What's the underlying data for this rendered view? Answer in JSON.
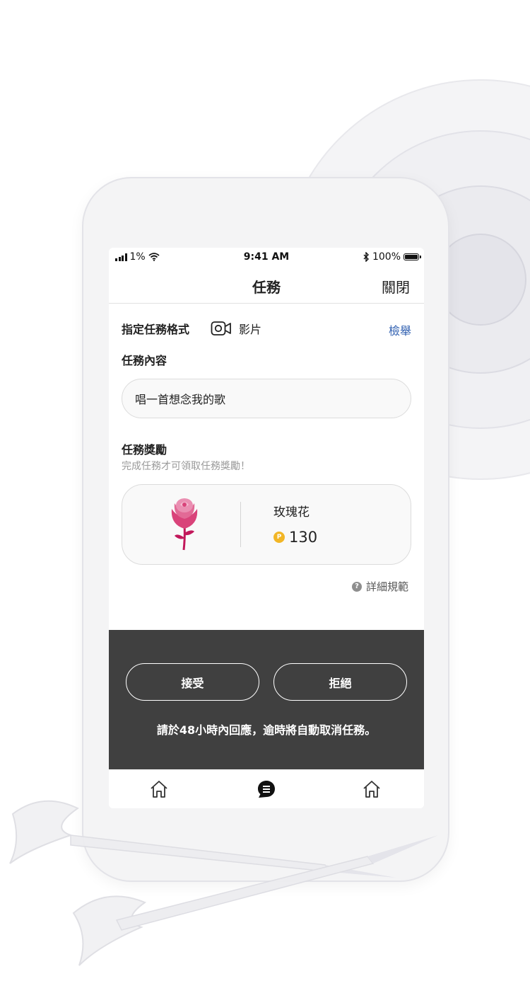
{
  "status_bar": {
    "signal_text": "1%",
    "time": "9:41 AM",
    "battery_text": "100%"
  },
  "nav": {
    "title": "任務",
    "close_label": "關閉"
  },
  "task": {
    "format_label": "指定任務格式",
    "format_icon": "video-camera-icon",
    "format_value": "影片",
    "report_label": "檢舉",
    "content_title": "任務內容",
    "content_value": "唱一首想念我的歌"
  },
  "reward": {
    "title": "任務獎勵",
    "subtitle": "完成任務才可領取任務獎勵！",
    "item_name": "玫瑰花",
    "coin_symbol": "P",
    "price": "130",
    "image_icon": "rose-icon"
  },
  "rules": {
    "label": "詳細規範",
    "icon": "question-icon"
  },
  "actions": {
    "accept_label": "接受",
    "reject_label": "拒絕",
    "notice": "請於48小時內回應，逾時將自動取消任務。"
  },
  "tabs": [
    {
      "icon": "home-icon"
    },
    {
      "icon": "chat-bubble-icon"
    },
    {
      "icon": "home-icon"
    }
  ],
  "colors": {
    "link_blue": "#2f5fb0",
    "panel_dark": "#404040",
    "coin_gold": "#f2b626",
    "rose_pink": "#d9437a"
  }
}
